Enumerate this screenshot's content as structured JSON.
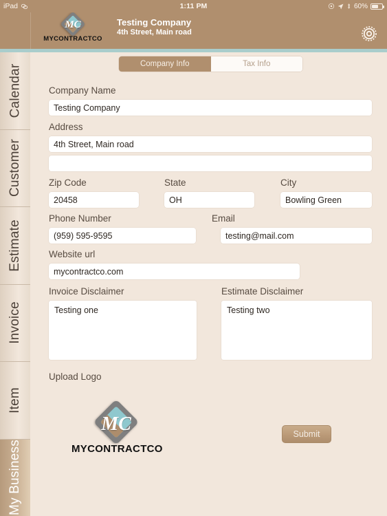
{
  "statusbar": {
    "device": "iPad",
    "link_icon": "link-icon",
    "time": "1:11 PM",
    "refresh_icon": "refresh-icon",
    "location_icon": "location-arrow-icon",
    "bluetooth_icon": "bluetooth-icon",
    "battery_percent": "60%",
    "battery_icon": "battery-icon"
  },
  "header": {
    "logo_mono": "MC",
    "logo_wordmark": "MYCONTRACTCO",
    "company_name": "Testing Company",
    "company_address": "4th Street, Main road",
    "settings_icon": "gear-icon",
    "bar_color": "#b08f6e",
    "rule_color": "#a9cdcc"
  },
  "sidebar": {
    "items": [
      {
        "label": "Calendar",
        "active": false
      },
      {
        "label": "Customer",
        "active": false
      },
      {
        "label": "Estimate",
        "active": false
      },
      {
        "label": "Invoice",
        "active": false
      },
      {
        "label": "Item",
        "active": false
      },
      {
        "label": "My Business",
        "active": true
      }
    ]
  },
  "tabs": [
    {
      "label": "Company Info",
      "selected": true
    },
    {
      "label": "Tax Info",
      "selected": false
    }
  ],
  "form": {
    "company_name": {
      "label": "Company Name",
      "value": "Testing Company"
    },
    "address": {
      "label": "Address",
      "line1": "4th Street, Main road",
      "line2": ""
    },
    "zip": {
      "label": "Zip Code",
      "value": "20458"
    },
    "state": {
      "label": "State",
      "value": "OH"
    },
    "city": {
      "label": "City",
      "value": "Bowling Green"
    },
    "phone": {
      "label": "Phone Number",
      "value": "(959) 595-9595"
    },
    "email": {
      "label": "Email",
      "value": "testing@mail.com"
    },
    "website": {
      "label": "Website url",
      "value": "mycontractco.com"
    },
    "invoice_disclaimer": {
      "label": "Invoice Disclaimer",
      "value": "Testing one"
    },
    "estimate_disclaimer": {
      "label": "Estimate Disclaimer",
      "value": "Testing two"
    },
    "upload_logo": {
      "label": "Upload Logo",
      "mono": "MC",
      "wordmark": "MYCONTRACTCO"
    },
    "submit_label": "Submit"
  },
  "colors": {
    "accent": "#b08f6e",
    "page_bg": "#f2e7dc",
    "teal": "#a9cdcc",
    "field_bg": "#ffffff"
  }
}
